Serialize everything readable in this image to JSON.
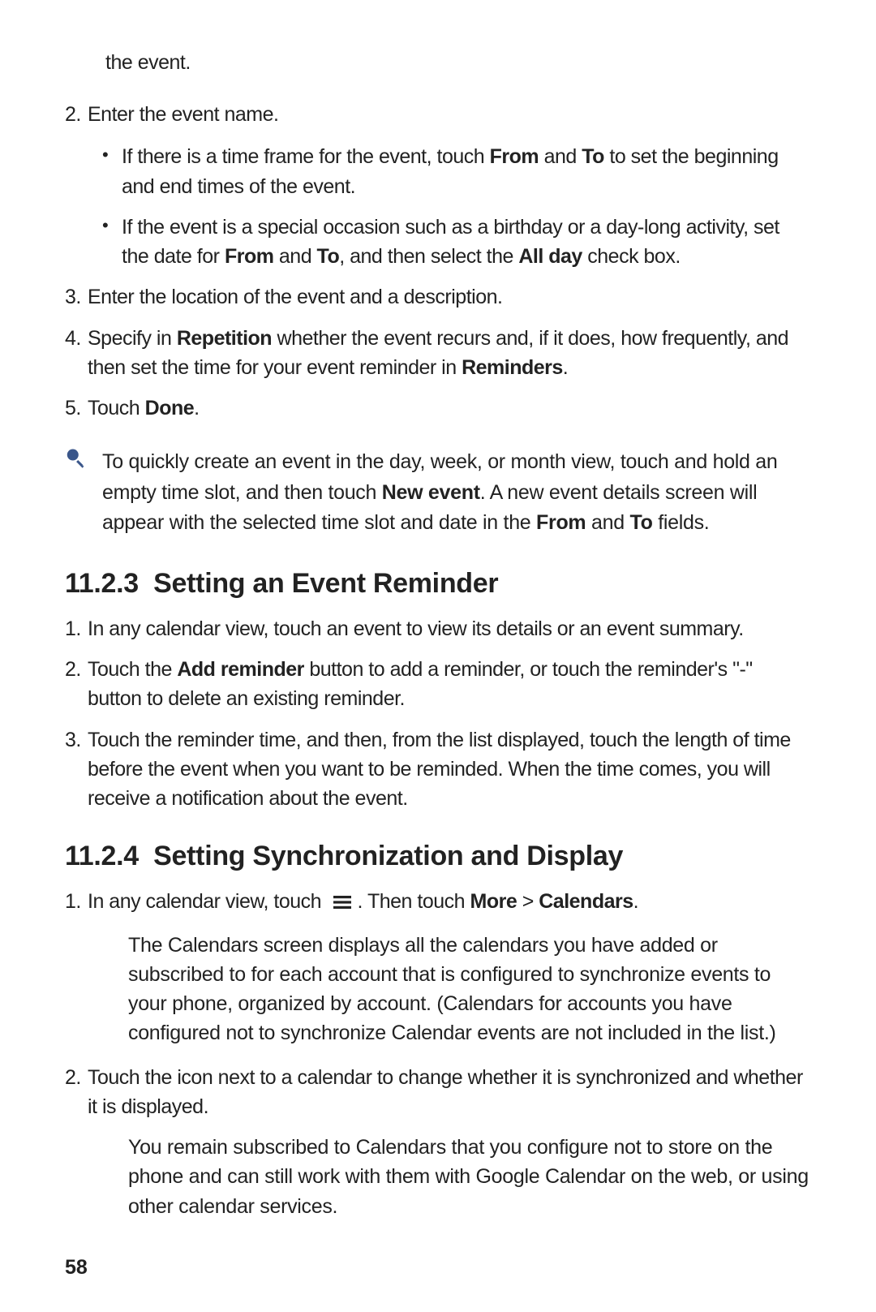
{
  "continued": "the event.",
  "list1": {
    "start": 2,
    "items": [
      {
        "text": "Enter the event name.",
        "bullets": [
          {
            "pre": "If there is a time frame for the event, touch ",
            "b1": "From",
            "mid1": " and ",
            "b2": "To",
            "post": " to set the beginning and end times of the event."
          },
          {
            "pre": "If the event is a special occasion such as a birthday or a day-long activity, set the date for ",
            "b1": "From",
            "mid1": " and ",
            "b2": "To",
            "mid2": ", and then select the ",
            "b3": "All day",
            "post": " check box."
          }
        ]
      },
      {
        "text": "Enter the location of the event and a description."
      },
      {
        "pre": "Specify in ",
        "b1": "Repetition",
        "mid1": " whether the event recurs and, if it does, how frequently, and then set the time for your event reminder in ",
        "b2": "Reminders",
        "post": "."
      },
      {
        "pre": "Touch ",
        "b1": "Done",
        "post": "."
      }
    ]
  },
  "tip": {
    "pre": "To quickly create an event in the day, week, or month view, touch and hold an empty time slot, and then touch ",
    "b1": "New event",
    "mid1": ". A new event details screen will appear with the selected time slot and date in the ",
    "b2": "From",
    "mid2": " and ",
    "b3": "To",
    "post": " fields."
  },
  "section1": {
    "number": "11.2.3",
    "title": "Setting an Event Reminder",
    "items": [
      {
        "text": "In any calendar view, touch an event to view its details or an event summary."
      },
      {
        "pre": "Touch the ",
        "b1": "Add reminder",
        "post": " button to add a reminder, or touch the reminder's \"-\" button to delete an existing reminder."
      },
      {
        "text": "Touch the reminder time, and then, from the list displayed, touch the length of time before the event when you want to be reminded. When the time comes, you will receive a notification about the event."
      }
    ]
  },
  "section2": {
    "number": "11.2.4",
    "title": "Setting Synchronization and Display",
    "items": [
      {
        "pre": "In any calendar view, touch ",
        "mid1": ". Then touch ",
        "b1": "More",
        "mid2": " > ",
        "b2": "Calendars",
        "post": ".",
        "indent": "The Calendars screen displays all the calendars you have added or subscribed to for each account that is configured to synchronize events to your phone, organized by account. (Calendars for accounts you have configured not to synchronize Calendar events are not included in the list.)"
      },
      {
        "text": "Touch the icon next to a calendar to change whether it is synchronized and whether it is displayed.",
        "indent": "You remain subscribed to Calendars that you configure not to store on the phone and can still work with them with Google Calendar on the web, or using other calendar services."
      }
    ]
  },
  "pageNumber": "58"
}
